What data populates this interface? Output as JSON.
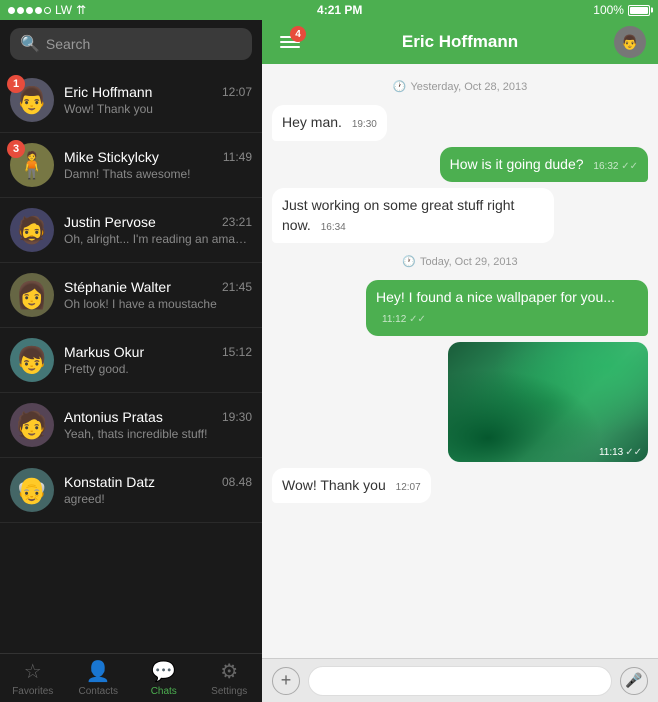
{
  "statusBar": {
    "signal": [
      "filled",
      "filled",
      "filled",
      "filled",
      "empty"
    ],
    "carrier": "LW",
    "wifi": true,
    "time": "4:21 PM",
    "battery": "100%"
  },
  "search": {
    "placeholder": "Search"
  },
  "chats": [
    {
      "id": 1,
      "name": "Eric Hoffmann",
      "time": "12:07",
      "preview": "Wow! Thank you",
      "badge": 1,
      "avatar": "👨"
    },
    {
      "id": 2,
      "name": "Mike Stickylcky",
      "time": "11:49",
      "preview": "Damn! Thats awesome!",
      "badge": 3,
      "avatar": "🧍"
    },
    {
      "id": 3,
      "name": "Justin Pervose",
      "time": "23:21",
      "preview": "Oh, alright... I'm reading an amazing article at...",
      "badge": 0,
      "avatar": "🧔"
    },
    {
      "id": 4,
      "name": "Stéphanie Walter",
      "time": "21:45",
      "preview": "Oh look! I have a moustache",
      "badge": 0,
      "avatar": "👩"
    },
    {
      "id": 5,
      "name": "Markus Okur",
      "time": "15:12",
      "preview": "Pretty good.",
      "badge": 0,
      "avatar": "👦"
    },
    {
      "id": 6,
      "name": "Antonius Pratas",
      "time": "19:30",
      "preview": "Yeah, thats incredible stuff!",
      "badge": 0,
      "avatar": "🧑"
    },
    {
      "id": 7,
      "name": "Konstatin Datz",
      "time": "08.48",
      "preview": "agreed!",
      "badge": 0,
      "avatar": "👴"
    }
  ],
  "nav": [
    {
      "id": "favorites",
      "label": "Favorites",
      "icon": "☆",
      "active": false
    },
    {
      "id": "contacts",
      "label": "Contacts",
      "icon": "👤",
      "active": false
    },
    {
      "id": "chats",
      "label": "Chats",
      "icon": "💬",
      "active": true
    },
    {
      "id": "settings",
      "label": "Settings",
      "icon": "⚙",
      "active": false
    }
  ],
  "activeChat": {
    "name": "Eric Hoffmann",
    "menuBadge": 4,
    "messages": [
      {
        "id": 1,
        "type": "date",
        "text": "Yesterday, Oct 28, 2013"
      },
      {
        "id": 2,
        "type": "received",
        "text": "Hey man.",
        "time": "19:30"
      },
      {
        "id": 3,
        "type": "sent",
        "text": "How is it going dude?",
        "time": "16:32",
        "check": "✓✓"
      },
      {
        "id": 4,
        "type": "received",
        "text": "Just working on some great stuff right now.",
        "time": "16:34"
      },
      {
        "id": 5,
        "type": "date",
        "text": "Today, Oct 29, 2013"
      },
      {
        "id": 6,
        "type": "sent",
        "text": "Hey! I found a nice wallpaper for you...",
        "time": "11:12",
        "check": "✓✓"
      },
      {
        "id": 7,
        "type": "image",
        "time": "11:13",
        "check": "✓✓"
      },
      {
        "id": 8,
        "type": "received",
        "text": "Wow! Thank you",
        "time": "12:07"
      }
    ]
  },
  "inputBar": {
    "placeholder": ""
  },
  "labels": {
    "add": "+",
    "mic": "🎤",
    "search_icon": "🔍"
  }
}
